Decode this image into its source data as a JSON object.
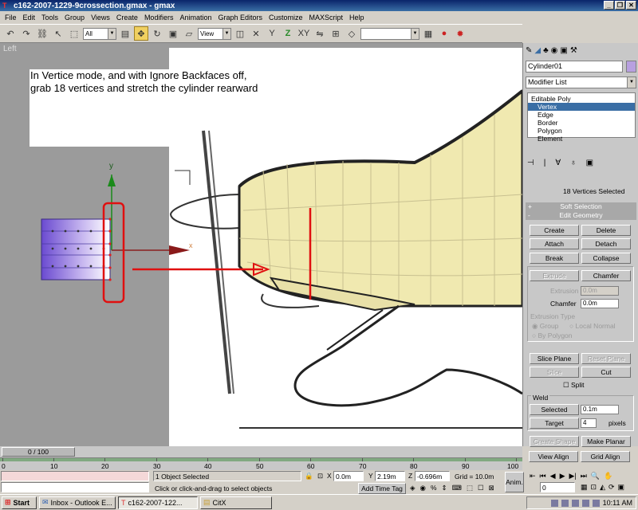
{
  "window": {
    "title": "c162-2007-1229-9crossection.gmax - gmax",
    "buttons": [
      "_",
      "❐",
      "✕"
    ]
  },
  "menu": [
    "File",
    "Edit",
    "Tools",
    "Group",
    "Views",
    "Create",
    "Modifiers",
    "Animation",
    "Graph Editors",
    "Customize",
    "MAXScript",
    "Help"
  ],
  "toolbar": {
    "selection_filter": "All",
    "ref_coord": "View"
  },
  "viewport": {
    "label": "Left",
    "annotation_line1": "In Vertice mode, and with Ignore Backfaces off,",
    "annotation_line2": "grab 18 vertices and stretch the cylinder rearward",
    "axis_x": "x",
    "axis_y": "y"
  },
  "command_panel": {
    "object_name": "Cylinder01",
    "modifier_list": "Modifier List",
    "stack": [
      "Editable Poly",
      "Vertex",
      "Edge",
      "Border",
      "Polygon",
      "Element"
    ],
    "selection_info": "18 Vertices Selected",
    "rollout_soft": "Soft Selection",
    "rollout_edit": "Edit Geometry",
    "btn_create": "Create",
    "btn_delete": "Delete",
    "btn_attach": "Attach",
    "btn_detach": "Detach",
    "btn_break": "Break",
    "btn_collapse": "Collapse",
    "btn_extrude": "Extrude",
    "btn_chamfer": "Chamfer",
    "lbl_extrusion": "Extrusion",
    "val_extrusion": "0.0m",
    "lbl_chamfer": "Chamfer",
    "val_chamfer": "0.0m",
    "extrusion_type": "Extrusion Type",
    "opt_group": "Group",
    "opt_local": "Local Normal",
    "opt_bypoly": "By Polygon",
    "btn_slice_plane": "Slice Plane",
    "btn_reset_plane": "Reset Plane",
    "btn_slice": "Slice",
    "btn_cut": "Cut",
    "split": "Split",
    "weld": "Weld",
    "btn_selected": "Selected",
    "val_selected": "0.1m",
    "btn_target": "Target",
    "val_target": "4",
    "pixels": "pixels",
    "btn_create_shape": "Create Shape",
    "btn_make_planar": "Make Planar",
    "btn_view_align": "View Align",
    "btn_grid_align": "Grid Align"
  },
  "timeline": {
    "slider": "0 / 100",
    "ticks": [
      "0",
      "10",
      "20",
      "30",
      "40",
      "50",
      "60",
      "70",
      "80",
      "90",
      "100"
    ]
  },
  "status": {
    "selected": "1 Object Selected",
    "prompt": "Click or click-and-drag to select objects",
    "x": "0.0m",
    "y": "2.19m",
    "z": "-0.696m",
    "grid": "Grid = 10.0m",
    "add_time_tag": "Add Time Tag",
    "anim": "Anim.",
    "frame": "0"
  },
  "taskbar": {
    "start": "Start",
    "tasks": [
      "Inbox - Outlook E...",
      "c162-2007-122...",
      "CitX"
    ],
    "clock": "10:11 AM"
  }
}
